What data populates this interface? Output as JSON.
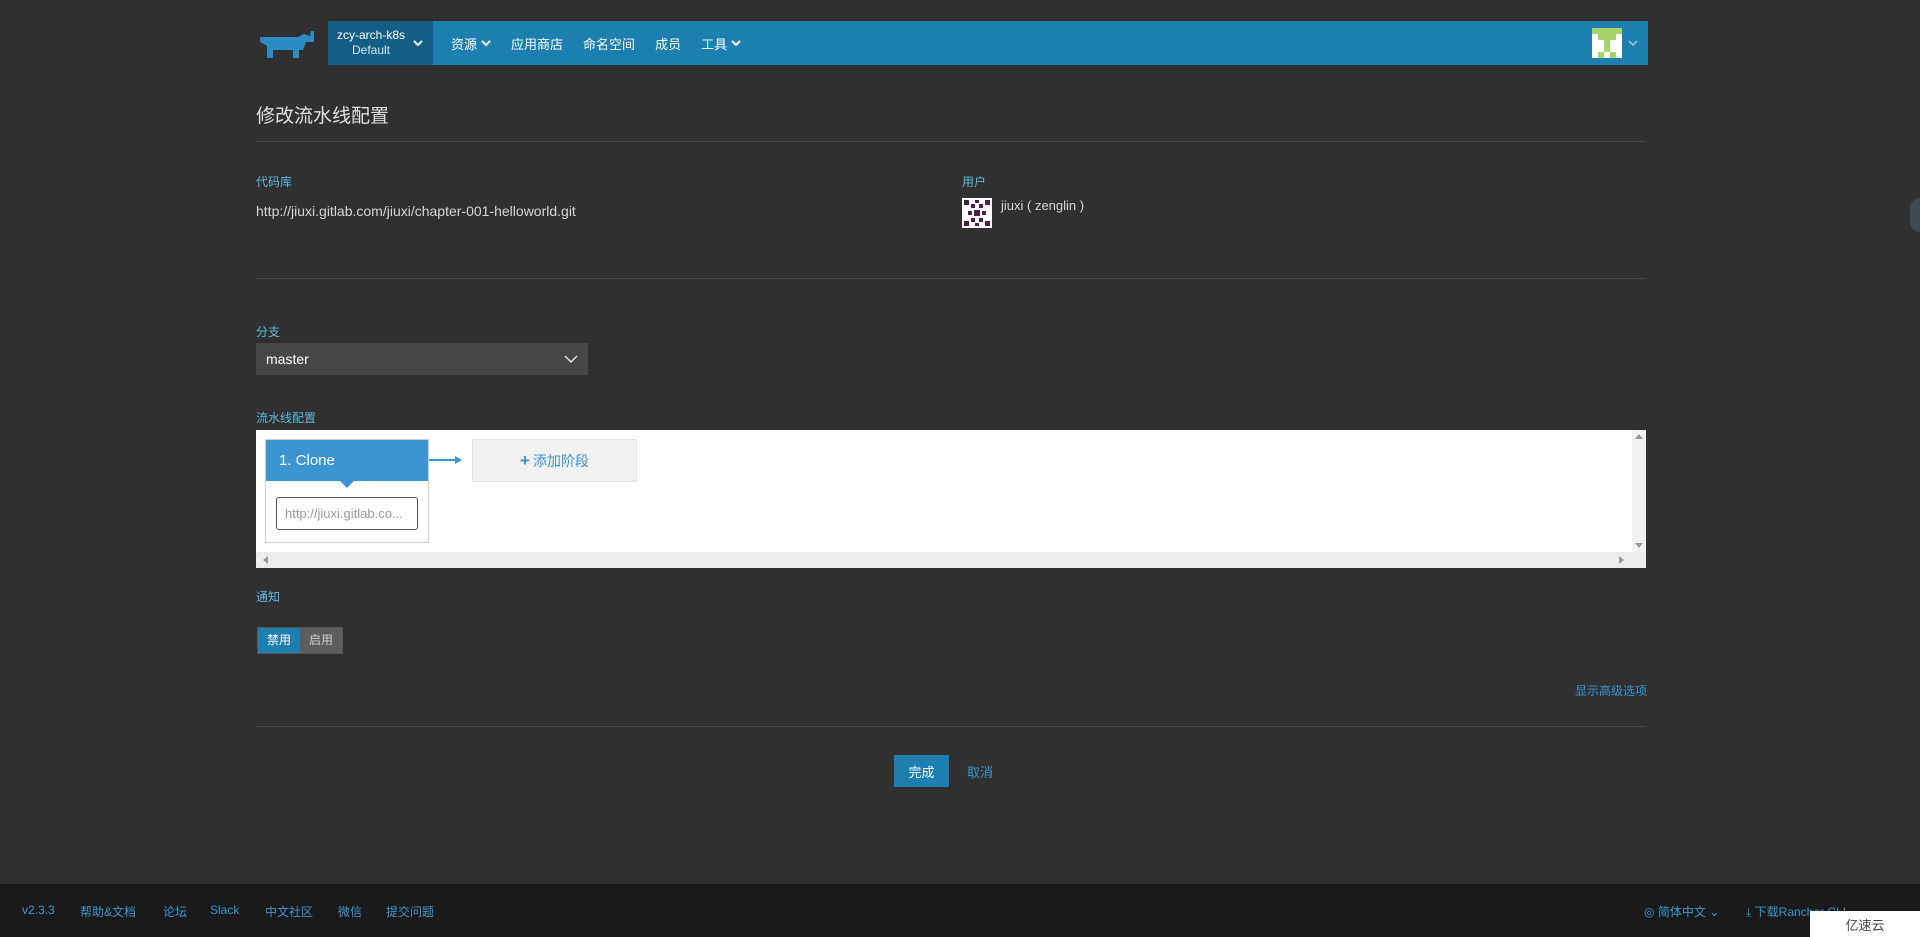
{
  "header": {
    "environment": {
      "name": "zcy-arch-k8s",
      "subtitle": "Default"
    },
    "nav": [
      {
        "label": "资源",
        "has_dropdown": true,
        "icon": "chevron-down-icon"
      },
      {
        "label": "应用商店",
        "has_dropdown": false
      },
      {
        "label": "命名空间",
        "has_dropdown": false
      },
      {
        "label": "成员",
        "has_dropdown": false
      },
      {
        "label": "工具",
        "has_dropdown": true,
        "icon": "chevron-down-icon"
      }
    ],
    "brand_color": "#1c7fb0"
  },
  "page": {
    "title": "修改流水线配置",
    "repo": {
      "label": "代码库",
      "url": "http://jiuxi.gitlab.com/jiuxi/chapter-001-helloworld.git"
    },
    "user": {
      "label": "用户",
      "name": "jiuxi ( zenglin )"
    },
    "branch": {
      "label": "分支",
      "value": "master"
    },
    "pipeline": {
      "label": "流水线配置",
      "stages": [
        {
          "title": "1. Clone",
          "step_text": "http://jiuxi.gitlab.co..."
        }
      ],
      "add_stage_label": "添加阶段",
      "add_stage_icon": "plus-icon"
    },
    "notify": {
      "label": "通知",
      "options": [
        "禁用",
        "启用"
      ],
      "selected": "禁用"
    },
    "advanced_link": "显示高级选项",
    "done_label": "完成",
    "cancel_label": "取消"
  },
  "footer": {
    "version": "v2.3.3",
    "links": [
      "帮助&文档",
      "论坛",
      "Slack",
      "中文社区",
      "微信",
      "提交问题"
    ],
    "language": "简体中文",
    "language_icon": "globe-icon",
    "download": "下载Rancher CLI",
    "download_icon": "download-icon"
  },
  "watermark": "亿速云"
}
